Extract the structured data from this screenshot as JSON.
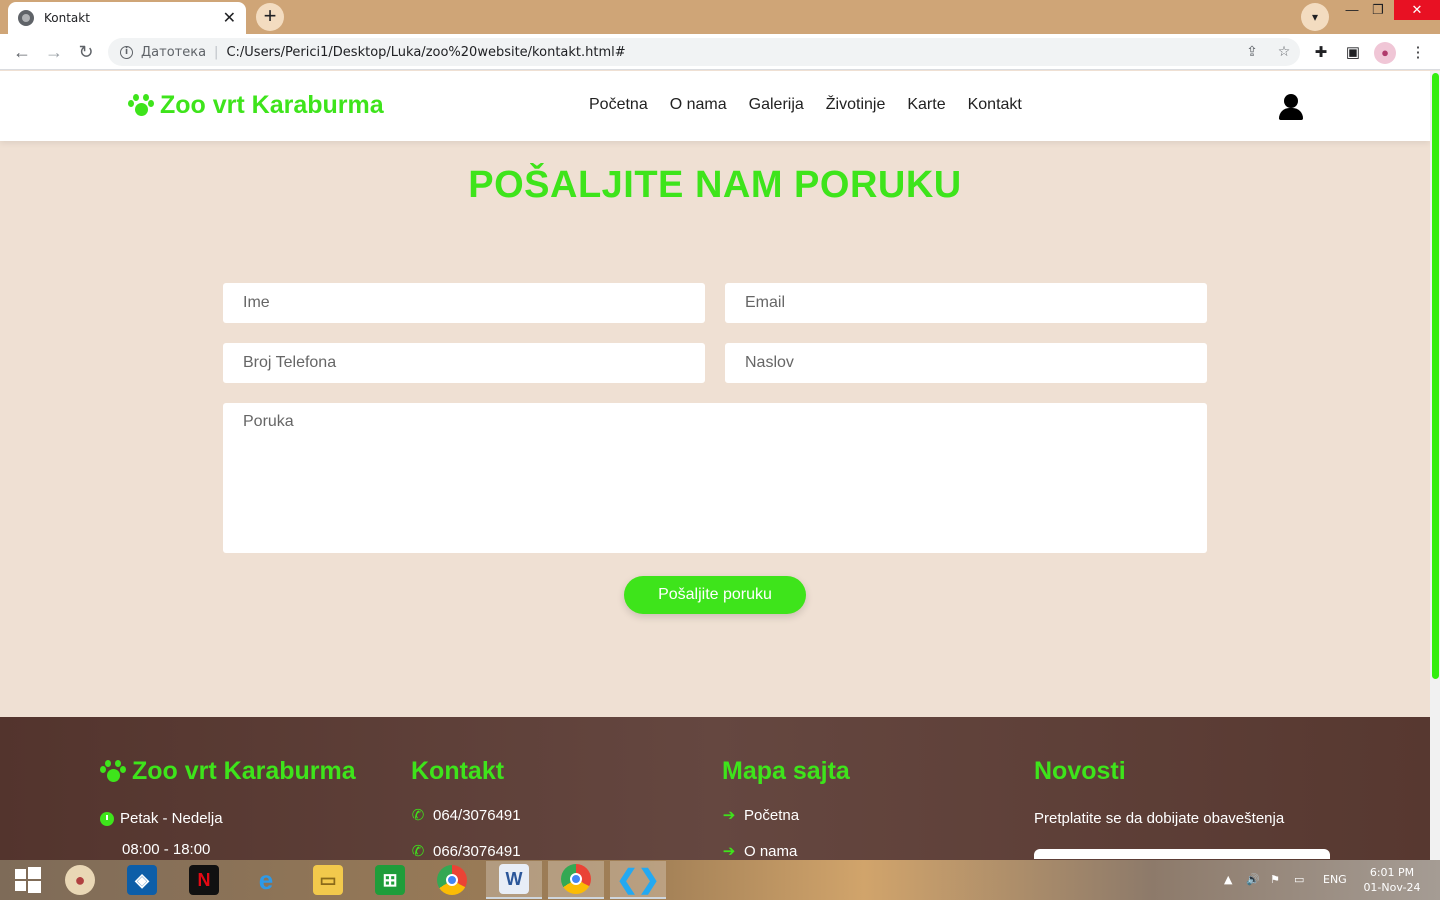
{
  "browser": {
    "tab_title": "Kontakt",
    "new_tab": "+",
    "tab_close": "✕",
    "address_label": "Датотека",
    "address_url": "C:/Users/Perici1/Desktop/Luka/zoo%20website/kontakt.html#"
  },
  "site": {
    "logo_text": "Zoo vrt Karaburma",
    "nav": [
      "Početna",
      "O nama",
      "Galerija",
      "Životinje",
      "Karte",
      "Kontakt"
    ]
  },
  "contact": {
    "title": "POŠALJITE NAM PORUKU",
    "name_placeholder": "Ime",
    "email_placeholder": "Email",
    "phone_placeholder": "Broj Telefona",
    "subject_placeholder": "Naslov",
    "message_placeholder": "Poruka",
    "submit_label": "Pošaljite poruku"
  },
  "footer": {
    "brand_title": "Zoo vrt Karaburma",
    "hours_days": "Petak - Nedelja",
    "hours_time": "08:00 - 18:00",
    "contact_title": "Kontakt",
    "phone_1": "064/3076491",
    "phone_2": "066/3076491",
    "sitemap_title": "Mapa sajta",
    "sitemap_1": "Početna",
    "sitemap_2": "O nama",
    "news_title": "Novosti",
    "news_text": "Pretplatite se da dobijate obaveštenja"
  },
  "taskbar": {
    "lang": "ENG",
    "time": "6:01 PM",
    "date": "01-Nov-24"
  },
  "colors": {
    "accent": "#3ee41b",
    "page_bg": "#efe0d3",
    "footer_bg": "#5c3d35"
  }
}
